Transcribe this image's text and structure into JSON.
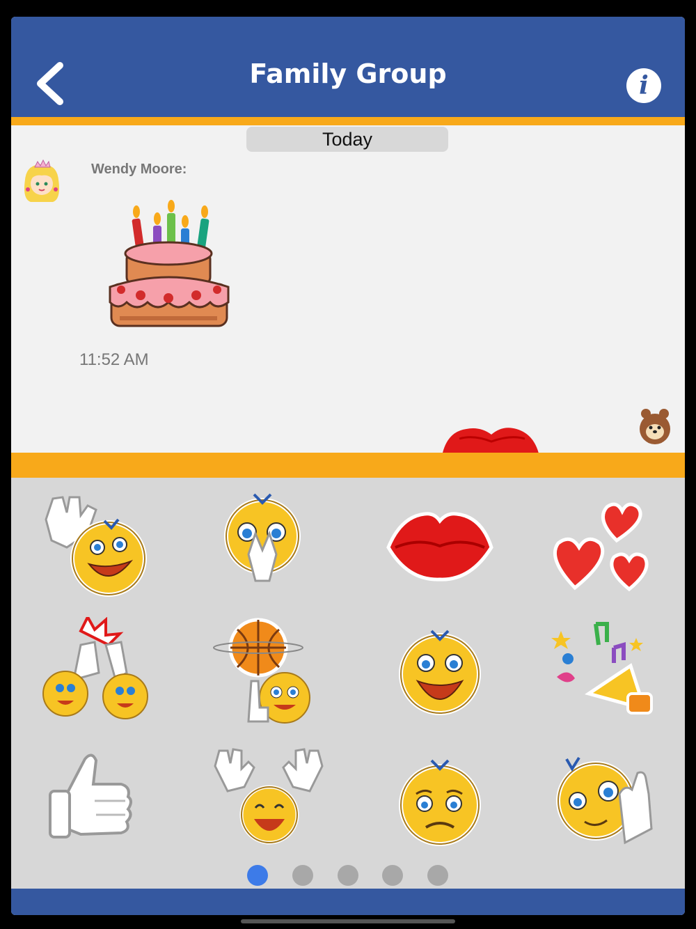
{
  "header": {
    "title": "Family Group",
    "back_icon": "chevron-left-icon",
    "info_icon": "info-icon",
    "info_glyph": "i",
    "color": "#3558a0"
  },
  "accent_color": "#f8a91a",
  "chat": {
    "date_divider": "Today",
    "messages": [
      {
        "sender": "Wendy Moore:",
        "avatar": "princess-avatar",
        "sticker": "birthday-cake-sticker",
        "time": "11:52 AM"
      },
      {
        "sender": "",
        "avatar": "bear-avatar",
        "sticker": "red-lips-sticker",
        "time": ""
      }
    ]
  },
  "sticker_tray": {
    "stickers": [
      "waving-smiley-sticker",
      "praying-smiley-sticker",
      "red-lips-sticker",
      "hearts-sticker",
      "high-five-sticker",
      "basketball-smiley-sticker",
      "laughing-smiley-sticker",
      "party-horn-sticker",
      "thumbs-up-sticker",
      "cheering-smiley-sticker",
      "sad-smiley-sticker",
      "waving-goodbye-smiley-sticker"
    ],
    "page_count": 5,
    "current_page": 1,
    "active_dot_color": "#3d7be8"
  }
}
